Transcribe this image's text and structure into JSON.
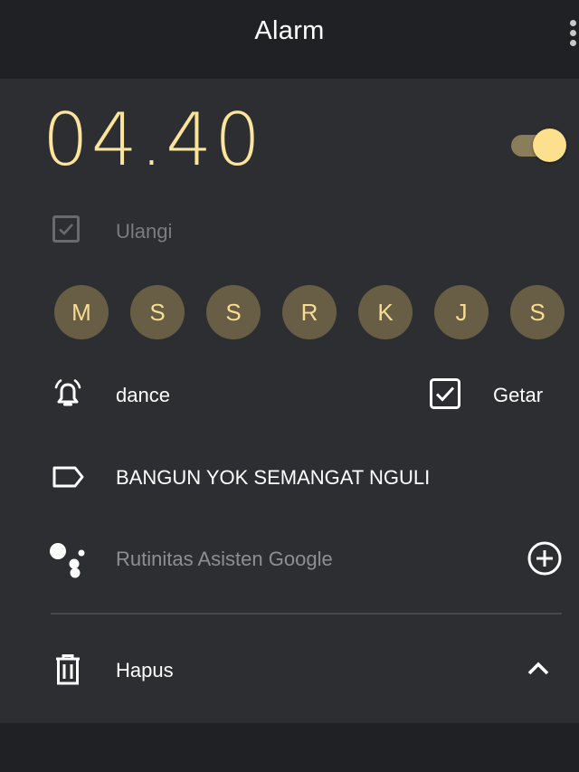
{
  "header": {
    "title": "Alarm"
  },
  "alarm": {
    "time": "04.40",
    "enabled": true,
    "repeat_label": "Ulangi",
    "days": [
      "M",
      "S",
      "S",
      "R",
      "K",
      "J",
      "S"
    ],
    "ringtone": "dance",
    "vibrate_label": "Getar",
    "label": "BANGUN YOK SEMANGAT NGULI",
    "assistant_label": "Rutinitas Asisten Google",
    "delete_label": "Hapus"
  },
  "colors": {
    "accent": "#fbe49b",
    "background": "#202124",
    "card": "#2d2e31",
    "day_chip": "#685e45"
  },
  "icons": {
    "overflow": "more-vert-icon",
    "repeat_checkbox": "checkbox-checked-icon",
    "ringtone": "alarm-bell-icon",
    "vibrate": "checkbox-checked-icon",
    "label": "label-tag-icon",
    "assistant": "google-assistant-icon",
    "add": "add-circle-icon",
    "delete": "trash-icon",
    "collapse": "chevron-up-icon"
  }
}
